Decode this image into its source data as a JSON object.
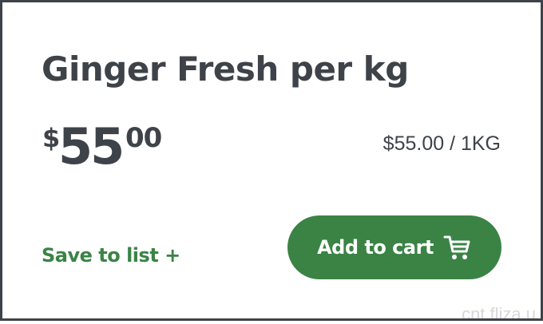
{
  "product": {
    "title": "Ginger Fresh per kg",
    "price": {
      "currency": "$",
      "dollars": "55",
      "cents": "00"
    },
    "unit_price": "$55.00 / 1KG"
  },
  "actions": {
    "save_label": "Save to list +",
    "add_to_cart_label": "Add to cart",
    "cart_icon": "shopping-cart-icon"
  },
  "watermark": "cnt.fliza.u",
  "colors": {
    "text": "#3d4349",
    "accent": "#3a8345",
    "border": "#3d4349"
  }
}
